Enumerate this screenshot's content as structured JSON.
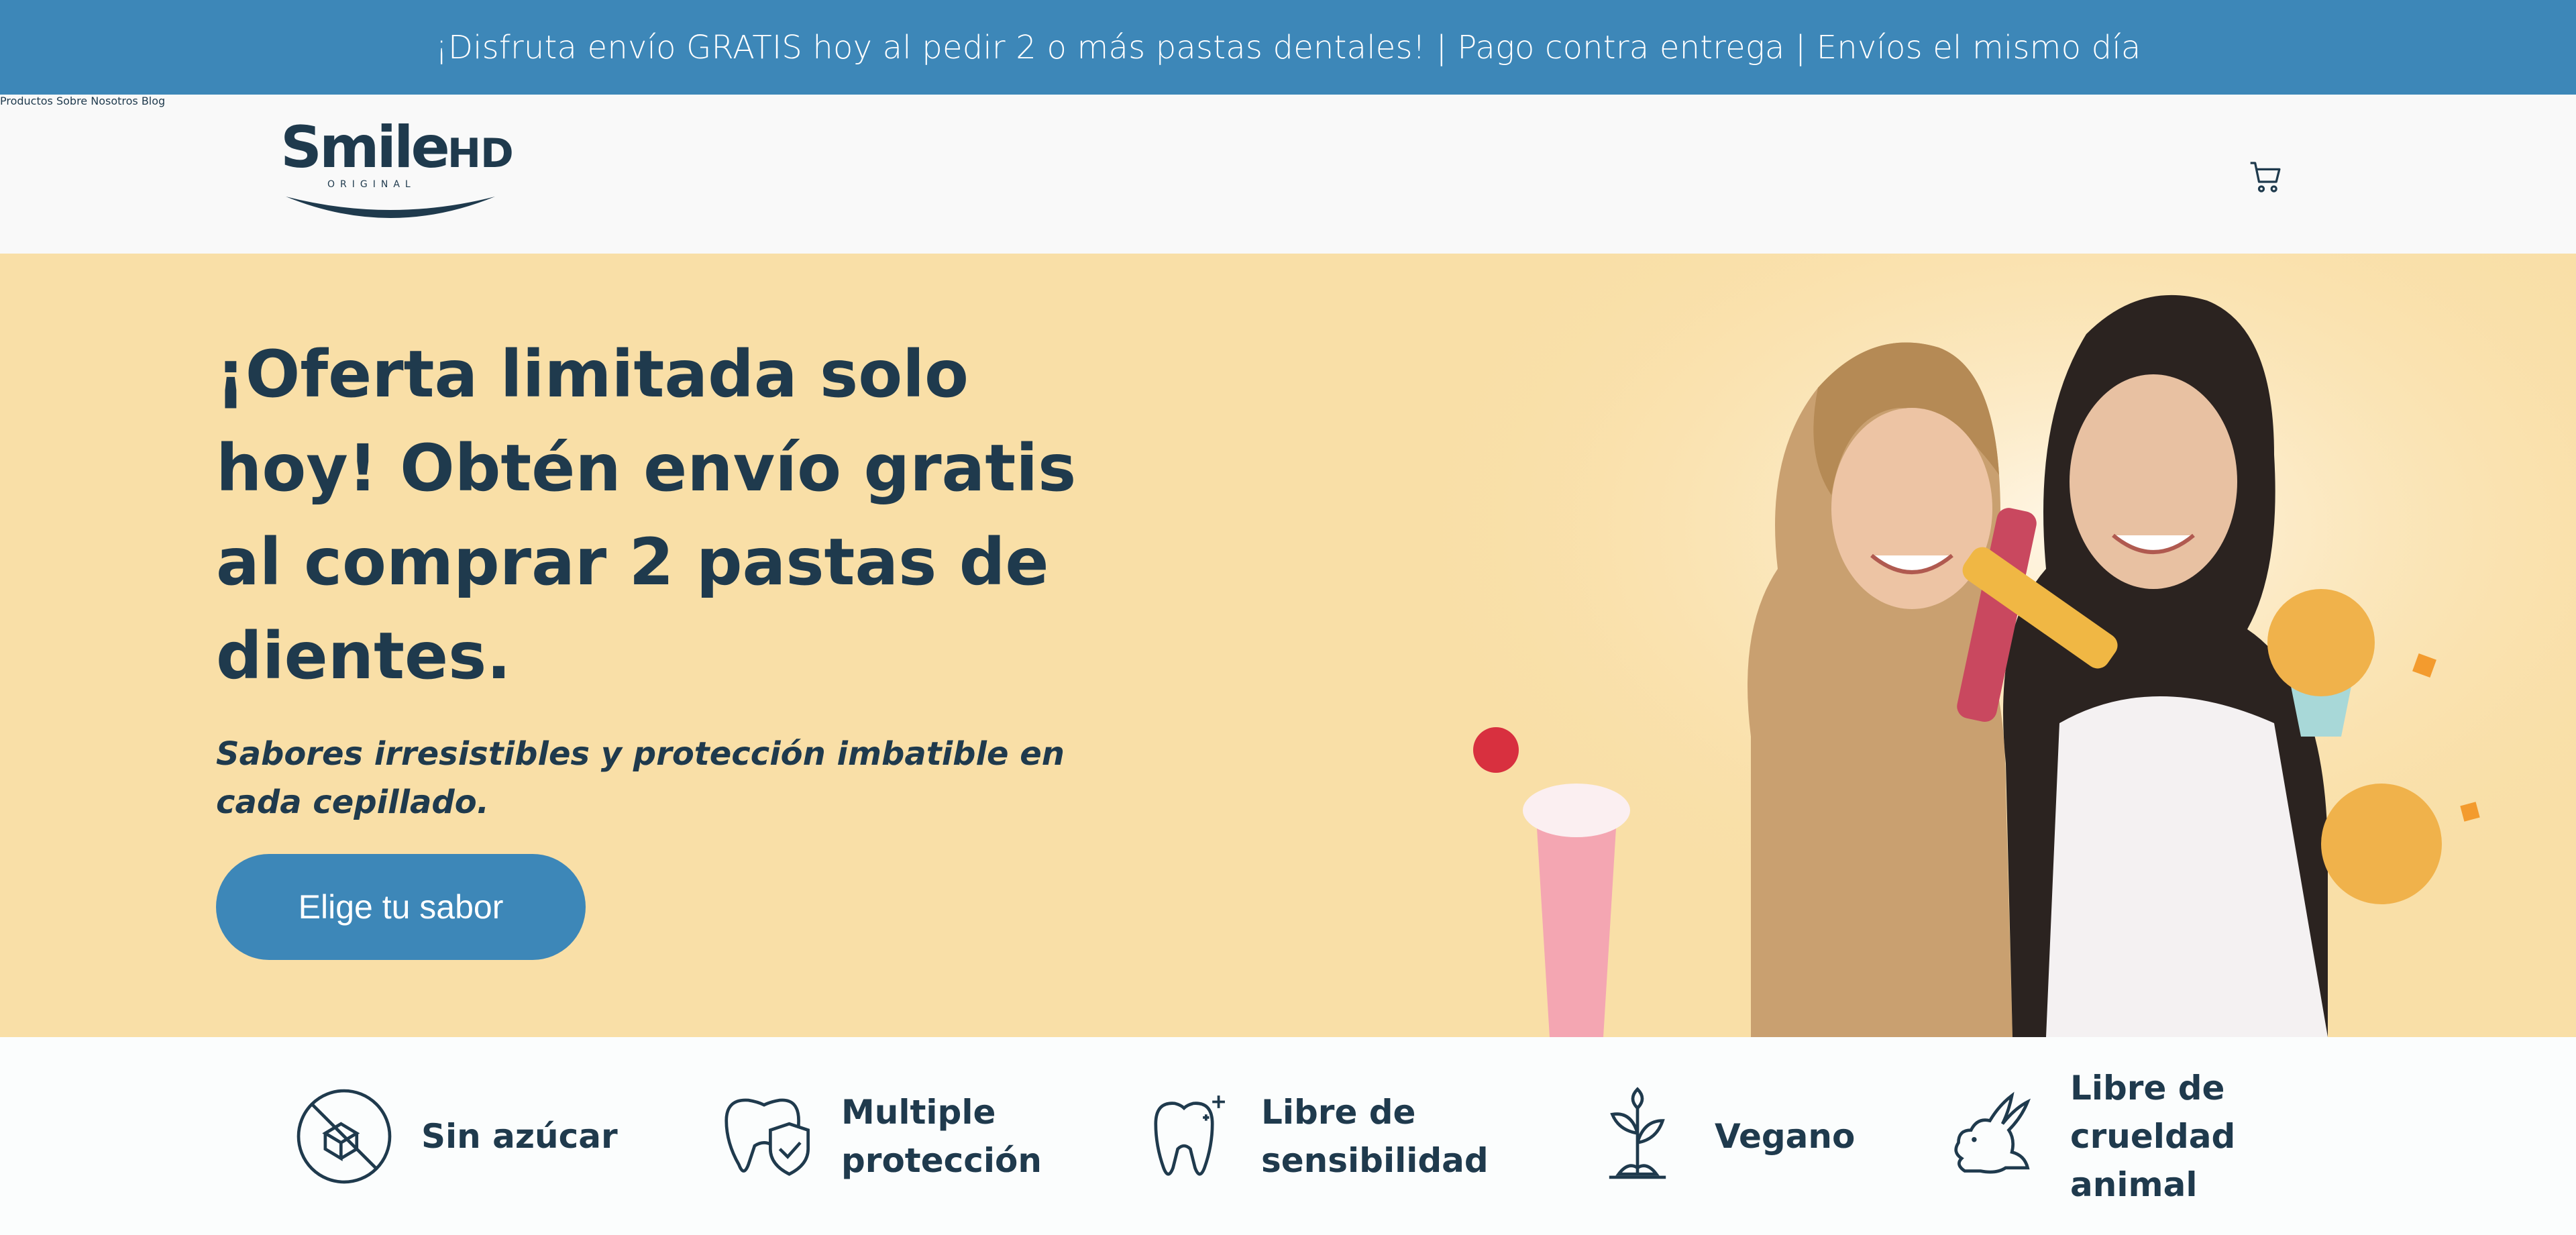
{
  "announcement": "¡Disfruta envío GRATIS hoy al pedir 2 o más pastas dentales! | Pago contra entrega | Envíos el mismo día",
  "brand": {
    "name_main": "Smile",
    "name_suffix": "HD",
    "tagline": "ORIGINAL"
  },
  "nav": {
    "products": "Productos",
    "about": "Sobre Nosotros",
    "blog": "Blog"
  },
  "hero": {
    "title": "¡Oferta limitada solo hoy! Obtén envío gratis al comprar 2 pastas de dientes.",
    "tagline": "Sabores irresistibles y protección imbatible en cada cepillado.",
    "cta": "Elige tu sabor"
  },
  "features": [
    {
      "label": "Sin azúcar",
      "icon": "no-sugar-icon"
    },
    {
      "label": "Multiple protección",
      "icon": "tooth-shield-icon"
    },
    {
      "label": "Libre de sensibilidad",
      "icon": "tooth-sparkle-icon"
    },
    {
      "label": "Vegano",
      "icon": "plant-icon"
    },
    {
      "label": "Libre de crueldad animal",
      "icon": "rabbit-icon"
    }
  ],
  "colors": {
    "primary": "#3d87b8",
    "dark": "#1f3a4d",
    "hero_bg": "#f9dfa7"
  }
}
